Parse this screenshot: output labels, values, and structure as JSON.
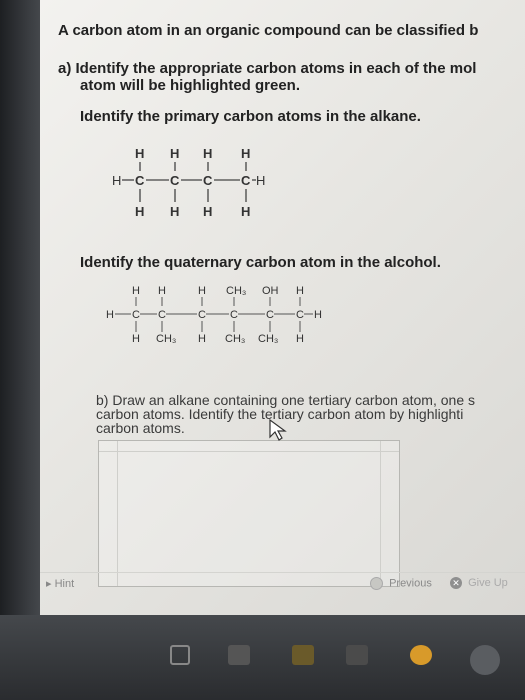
{
  "intro": "A carbon atom in an organic compound can be classified b",
  "part_a_line1": "a) Identify the appropriate carbon atoms in each of the mol",
  "part_a_line2": "atom will be highlighted green.",
  "q1": "Identify the primary carbon atoms in the alkane.",
  "q2": "Identify the quaternary carbon atom in the alcohol.",
  "part_b_line1": "b) Draw an alkane containing one tertiary carbon atom, one s",
  "part_b_line2": "carbon atoms. Identify the tertiary carbon atom by highlighti",
  "part_b_line3": "carbon atoms.",
  "alkane": {
    "top": [
      "H",
      "H",
      "H",
      "H"
    ],
    "main": [
      "H",
      "C",
      "C",
      "C",
      "C",
      "H"
    ],
    "bottom": [
      "H",
      "H",
      "H",
      "H"
    ]
  },
  "alcohol": {
    "top": [
      "H",
      "H",
      "H",
      "CH₃",
      "OH",
      "H"
    ],
    "main": [
      "H",
      "C",
      "C",
      "C",
      "C",
      "C",
      "C",
      "H"
    ],
    "bottom": [
      "H",
      "CH₃",
      "H",
      "CH₃",
      "CH₃",
      "H"
    ]
  },
  "footer": {
    "hint": "Hint",
    "previous": "Previous",
    "give_up": "Give Up"
  },
  "colors": {
    "highlight": "#2aa44a",
    "text": "#222222"
  }
}
